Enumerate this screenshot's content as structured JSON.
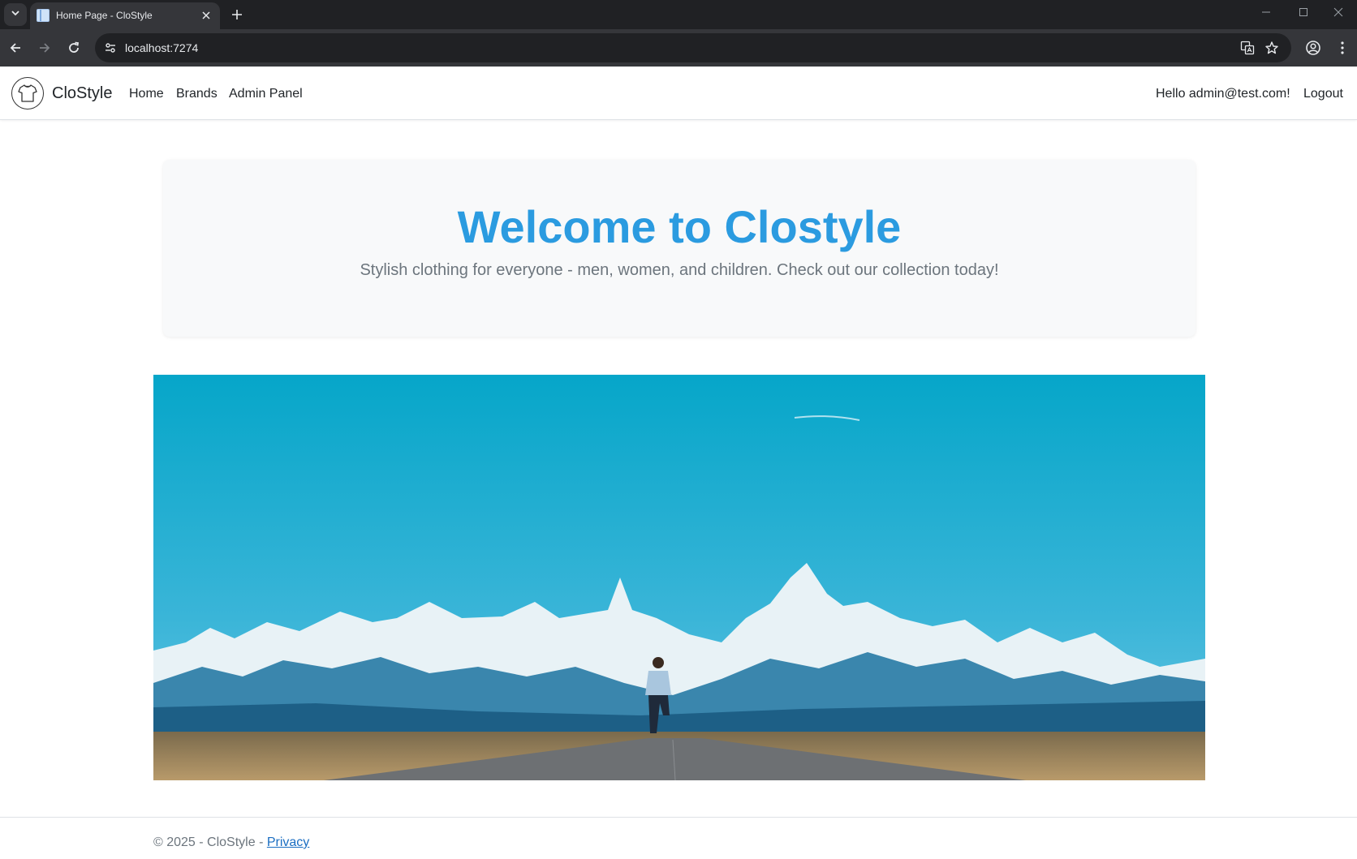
{
  "browser": {
    "tab_title": "Home Page - CloStyle",
    "url": "localhost:7274"
  },
  "navbar": {
    "brand": "CloStyle",
    "links": [
      "Home",
      "Brands",
      "Admin Panel"
    ],
    "greeting": "Hello admin@test.com!",
    "logout": "Logout"
  },
  "hero": {
    "title": "Welcome to Clostyle",
    "lead": "Stylish clothing for everyone - men, women, and children. Check out our collection today!"
  },
  "footer": {
    "copyright": "© 2025 - CloStyle - ",
    "privacy": "Privacy"
  }
}
